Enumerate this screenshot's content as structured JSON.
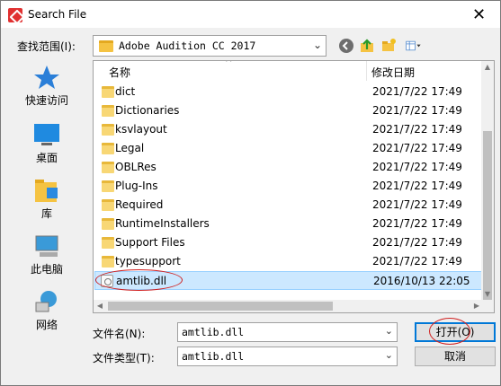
{
  "window": {
    "title": "Search File",
    "close_glyph": "✕"
  },
  "lookin": {
    "label": "查找范围(I):",
    "value": "Adobe Audition CC 2017"
  },
  "toolbar": {
    "icons": [
      "back-icon",
      "up-folder-icon",
      "new-folder-icon",
      "view-menu-icon"
    ]
  },
  "places": [
    {
      "label": "快速访问",
      "icon": "star-icon"
    },
    {
      "label": "桌面",
      "icon": "desktop-icon"
    },
    {
      "label": "库",
      "icon": "library-icon"
    },
    {
      "label": "此电脑",
      "icon": "computer-icon"
    },
    {
      "label": "网络",
      "icon": "network-icon"
    }
  ],
  "list": {
    "col_name": "名称",
    "col_date": "修改日期",
    "rows": [
      {
        "name": "dict",
        "date": "2021/7/22 17:49"
      },
      {
        "name": "Dictionaries",
        "date": "2021/7/22 17:49"
      },
      {
        "name": "ksvlayout",
        "date": "2021/7/22 17:49"
      },
      {
        "name": "Legal",
        "date": "2021/7/22 17:49"
      },
      {
        "name": "OBLRes",
        "date": "2021/7/22 17:49"
      },
      {
        "name": "Plug-Ins",
        "date": "2021/7/22 17:49"
      },
      {
        "name": "Required",
        "date": "2021/7/22 17:49"
      },
      {
        "name": "RuntimeInstallers",
        "date": "2021/7/22 17:49"
      },
      {
        "name": "Support Files",
        "date": "2021/7/22 17:49"
      },
      {
        "name": "typesupport",
        "date": "2021/7/22 17:49"
      }
    ],
    "selected": {
      "name": "amtlib.dll",
      "date": "2016/10/13 22:05"
    }
  },
  "filename": {
    "label": "文件名(N):",
    "value": "amtlib.dll"
  },
  "filetype": {
    "label": "文件类型(T):",
    "value": "amtlib.dll"
  },
  "buttons": {
    "open": "打开(O)",
    "cancel": "取消"
  },
  "colors": {
    "selection": "#cce8ff",
    "annotation": "#d02020",
    "accent": "#0078d7"
  }
}
